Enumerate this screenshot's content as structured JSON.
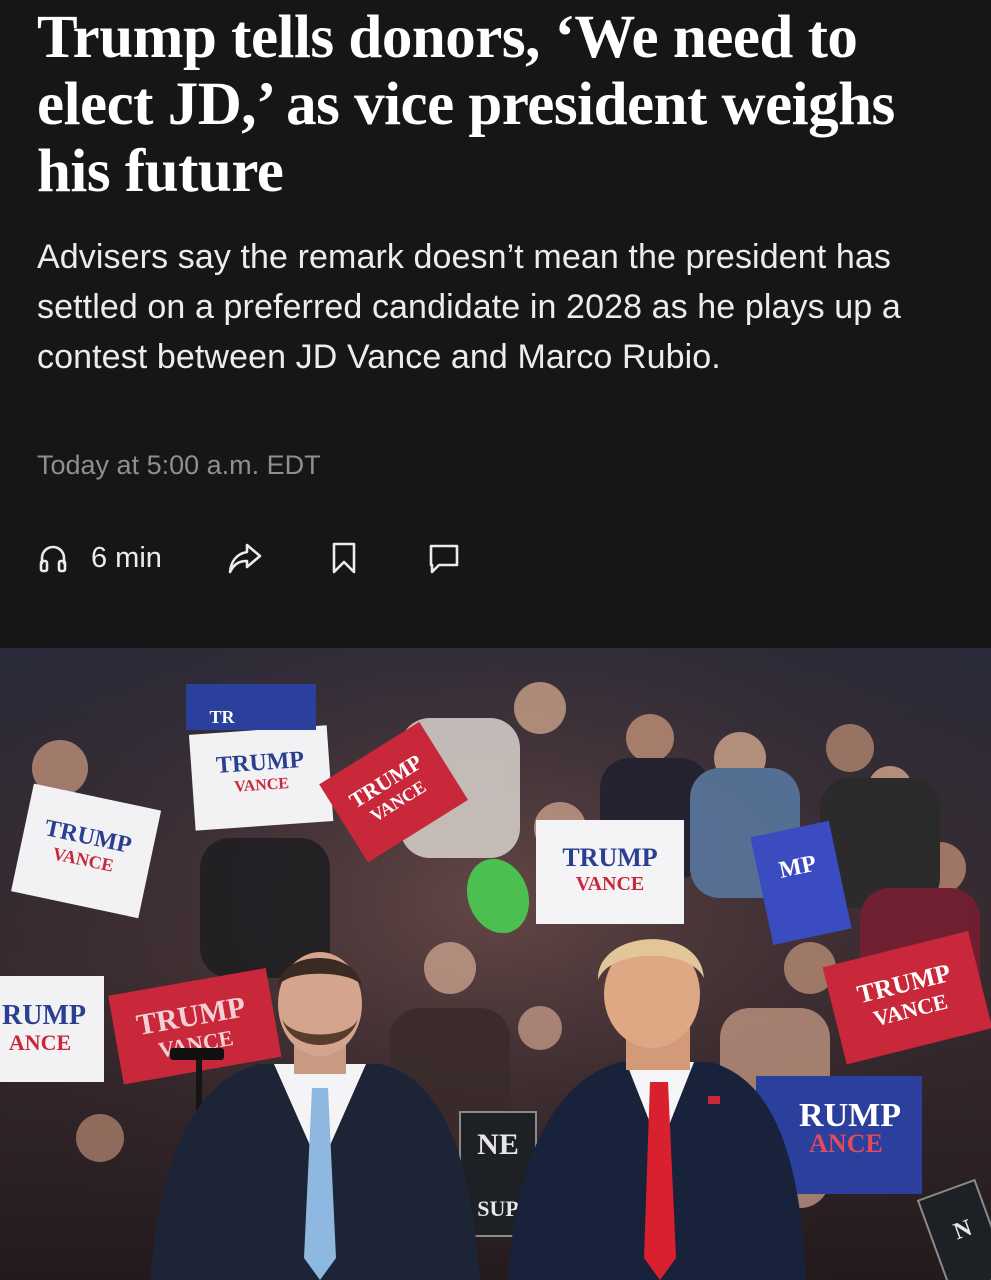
{
  "article": {
    "headline": "Trump tells donors, ‘We need to elect JD,’ as vice president weighs his future",
    "dek": "Advisers say the remark doesn’t mean the president has settled on a preferred candidate in 2028 as he plays up a contest between JD Vance and Marco Rubio.",
    "timestamp": "Today at 5:00 a.m. EDT"
  },
  "actions": {
    "listen_label": "6 min",
    "icons": [
      "headphones-icon",
      "share-icon",
      "bookmark-icon",
      "comment-icon"
    ]
  },
  "photo": {
    "sign_text": {
      "trump": "TRUMP",
      "vance": "VANCE",
      "rump": "RUMP",
      "ance": "ANCE",
      "ne": "NE",
      "sup": "SUP",
      "tr": "TR",
      "mp": "MP",
      "n": "N"
    }
  },
  "colors": {
    "background": "#161616",
    "headline": "#ffffff",
    "dek": "#ececec",
    "timestamp": "#8f8f8f",
    "sign_red": "#c8283a",
    "sign_blue": "#2b3f9c"
  }
}
